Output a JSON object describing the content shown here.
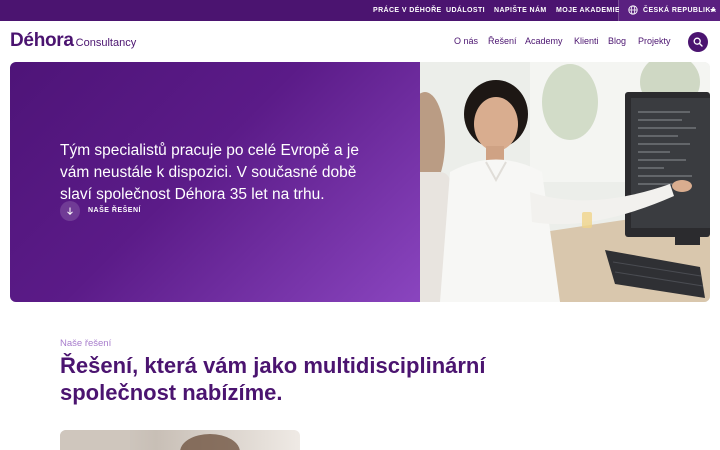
{
  "topbar": {
    "links": [
      "PRÁCE V DÉHOŘE",
      "UDÁLOSTI",
      "NAPIŠTE NÁM",
      "MOJE AKADEMIE"
    ],
    "country": "ČESKÁ REPUBLIKA"
  },
  "header": {
    "logo_brand": "Déhora",
    "logo_sub": "Consultancy",
    "nav": [
      "O nás",
      "Řešení",
      "Academy",
      "Klienti",
      "Blog",
      "Projekty"
    ]
  },
  "hero": {
    "text": "Tým specialistů pracuje po celé Evropě a je vám neustále k dispozici. V současné době slaví společnost Déhora 35 let na trhu.",
    "cta_label": "NAŠE ŘEŠENÍ"
  },
  "section": {
    "eyebrow": "Naše řešení",
    "title": "Řešení, která vám jako multidisciplinární společnost nabízíme."
  },
  "colors": {
    "brand_purple": "#4b1470",
    "hero_gradient_end": "#8a45bf",
    "eyebrow": "#a77ccc"
  },
  "icons": {
    "country": "globe-icon",
    "search": "search-icon",
    "cta": "arrow-down-icon"
  }
}
